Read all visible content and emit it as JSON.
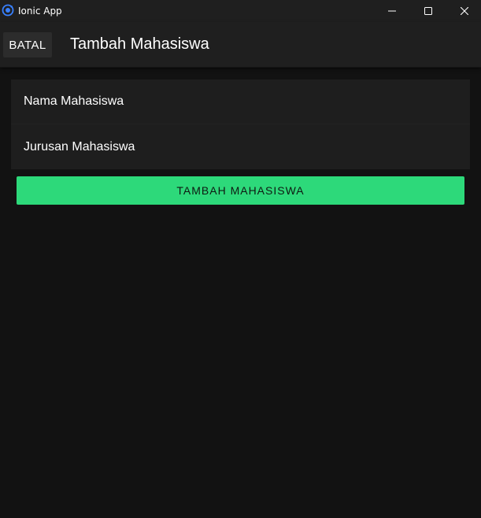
{
  "window": {
    "title": "Ionic App",
    "icon": "ionic-logo-icon",
    "controls": [
      "minimize-icon",
      "maximize-icon",
      "close-icon"
    ]
  },
  "toolbar": {
    "cancel_label": "BATAL",
    "title": "Tambah Mahasiswa"
  },
  "form": {
    "fields": [
      {
        "placeholder": "Nama Mahasiswa"
      },
      {
        "placeholder": "Jurusan Mahasiswa"
      }
    ],
    "submit_label": "TAMBAH MAHASISWA"
  },
  "colors": {
    "background": "#121212",
    "toolbar": "#1f1f1f",
    "list": "#1e1e1e",
    "accent": "#2dd97a",
    "window_icon": "#3880ff"
  }
}
